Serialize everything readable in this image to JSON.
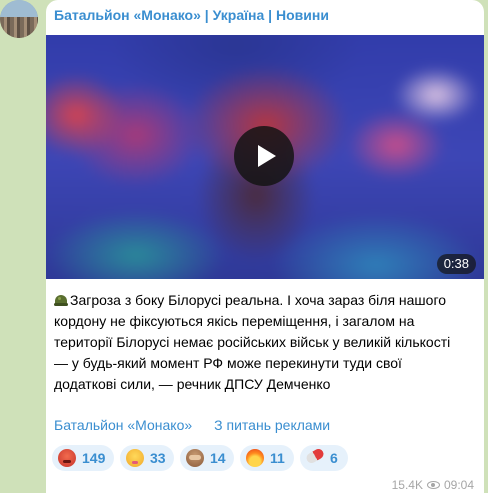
{
  "channel": {
    "title": "Батальйон «Монако» | Україна | Новини"
  },
  "video": {
    "duration": "0:38"
  },
  "post": {
    "emoji_icon": "military-helmet-icon",
    "line1": "Загроза з боку Білорусі реальна. І хоча зараз біля нашого",
    "line2": "кордону не фіксуються якісь переміщення, і загалом на",
    "line3": "території Білорусі немає російських військ у великій кількості",
    "line4": "— у будь-який момент РФ може перекинути туди свої",
    "line5_bold": "додаткові сили,",
    "line5_rest": " — речник ДПСУ Демченко"
  },
  "links": {
    "channel": "Батальйон «Монако»",
    "ads": "З питань реклами"
  },
  "reactions": [
    {
      "icon": "angry-face-icon",
      "count": "149"
    },
    {
      "icon": "woozy-face-icon",
      "count": "33"
    },
    {
      "icon": "see-no-evil-monkey-icon",
      "count": "14"
    },
    {
      "icon": "fire-icon",
      "count": "11"
    },
    {
      "icon": "pill-icon",
      "count": "6"
    }
  ],
  "meta": {
    "views": "15.4K",
    "time": "09:04"
  },
  "colors": {
    "accent": "#3a8ed0",
    "reaction_bg": "#e6f1fb",
    "chat_bg": "#cfe1b9"
  }
}
